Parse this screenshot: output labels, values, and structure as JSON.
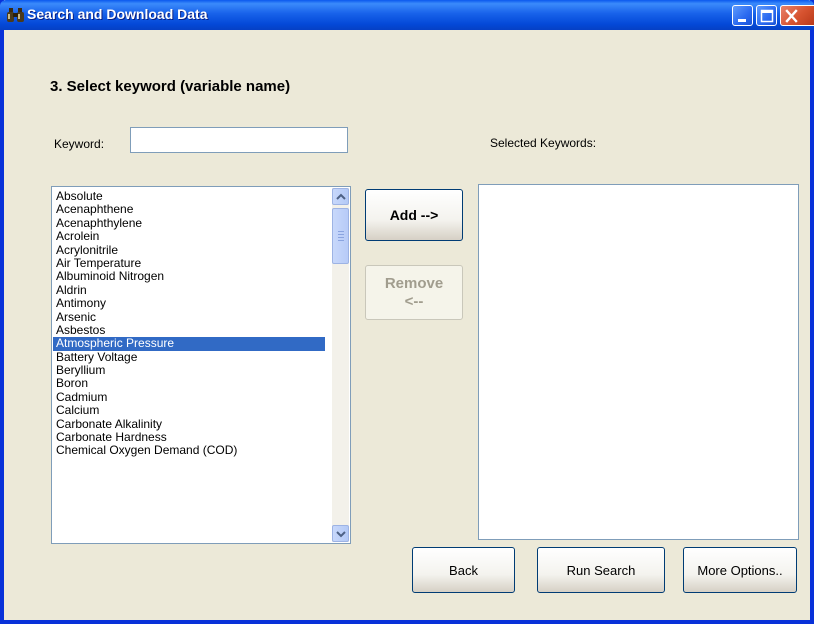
{
  "window": {
    "title": "Search and Download Data",
    "icon": "binoculars-icon"
  },
  "step": {
    "heading": "3. Select keyword (variable name)"
  },
  "keyword": {
    "label": "Keyword:",
    "value": ""
  },
  "selected": {
    "label": "Selected Keywords:",
    "items": []
  },
  "keyword_list": {
    "items": [
      "Absolute",
      "Acenaphthene",
      "Acenaphthylene",
      "Acrolein",
      "Acrylonitrile",
      "Air Temperature",
      "Albuminoid Nitrogen",
      "Aldrin",
      "Antimony",
      "Arsenic",
      "Asbestos",
      "Atmospheric Pressure",
      "Battery Voltage",
      "Beryllium",
      "Boron",
      "Cadmium",
      "Calcium",
      "Carbonate Alkalinity",
      "Carbonate Hardness",
      "Chemical Oxygen Demand (COD)"
    ],
    "selected_item": "Atmospheric Pressure"
  },
  "buttons": {
    "add": "Add -->",
    "remove_line1": "Remove",
    "remove_line2": "<--",
    "back": "Back",
    "run_search": "Run Search",
    "more_options": "More Options.."
  },
  "colors": {
    "titlebar": "#0a58ee",
    "selection": "#316ac5",
    "dialog_bg": "#ece9d8"
  }
}
